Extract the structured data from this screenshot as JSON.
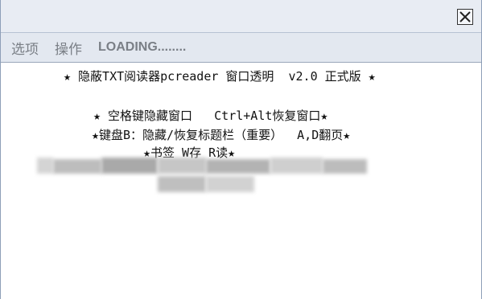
{
  "window": {
    "close_icon": "close-icon"
  },
  "menu": {
    "items": [
      "选项",
      "操作"
    ],
    "loading_text": "LOADING........"
  },
  "content": {
    "lines": [
      "★ 隐蔽TXT阅读器pcreader 窗口透明  v2.0 正式版 ★",
      "★ 空格键隐藏窗口   Ctrl+Alt恢复窗口★",
      "★键盘B：隐藏/恢复标题栏（重要）  A,D翻页★",
      "★书签 W存 R读★"
    ]
  }
}
